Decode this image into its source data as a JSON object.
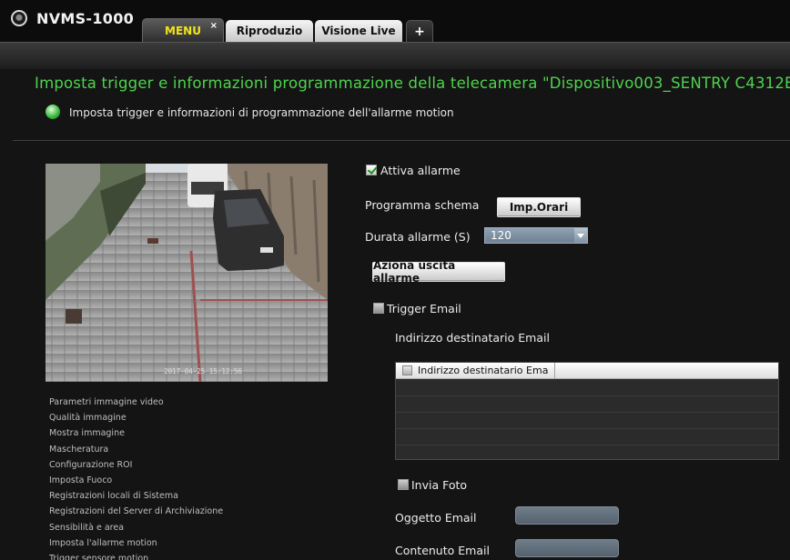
{
  "app": {
    "title": "NVMS-1000",
    "logo_icon": "camera-eye-icon"
  },
  "tabs": [
    {
      "label": "MENU",
      "active": true,
      "close": "×"
    },
    {
      "label": "Riproduzio",
      "active": false
    },
    {
      "label": "Visione Live",
      "active": false
    },
    {
      "label": "+",
      "active": false
    }
  ],
  "page": {
    "heading": "Imposta trigger e informazioni programmazione della telecamera \"Dispositivo003_SENTRY C4312E",
    "subheading": "Imposta trigger e informazioni di programmazione dell'allarme motion",
    "subheading_icon": "info-bulb-icon"
  },
  "preview": {
    "timestamp": "2017-04-25 15:12:56"
  },
  "side_menu": [
    "Parametri immagine video",
    "Qualità immagine",
    "Mostra immagine",
    "Mascheratura",
    "Configurazione ROI",
    "Imposta Fuoco",
    "Registrazioni locali di Sistema",
    "Registrazioni del Server di Archiviazione",
    "Sensibilità e area",
    "Imposta l'allarme motion",
    "Trigger sensore motion"
  ],
  "form": {
    "enable_alarm": {
      "label": "Attiva allarme",
      "checked": true
    },
    "schedule": {
      "label": "Programma schema",
      "button": "Imp.Orari"
    },
    "duration": {
      "label": "Durata allarme (S)",
      "value": "120"
    },
    "alarm_output_button": "Aziona uscita allarme",
    "trigger_email": {
      "label": "Trigger Email",
      "checked": false
    },
    "recipient_label": "Indirizzo destinatario Email",
    "recipient_table_header": "Indirizzo destinatario Ema",
    "send_photo": {
      "label": "Invia Foto",
      "checked": false
    },
    "subject_label": "Oggetto Email",
    "content_label": "Contenuto Email"
  },
  "colors": {
    "heading_green": "#4fd34f",
    "active_tab_text": "#f0e41c",
    "background": "#141414"
  }
}
